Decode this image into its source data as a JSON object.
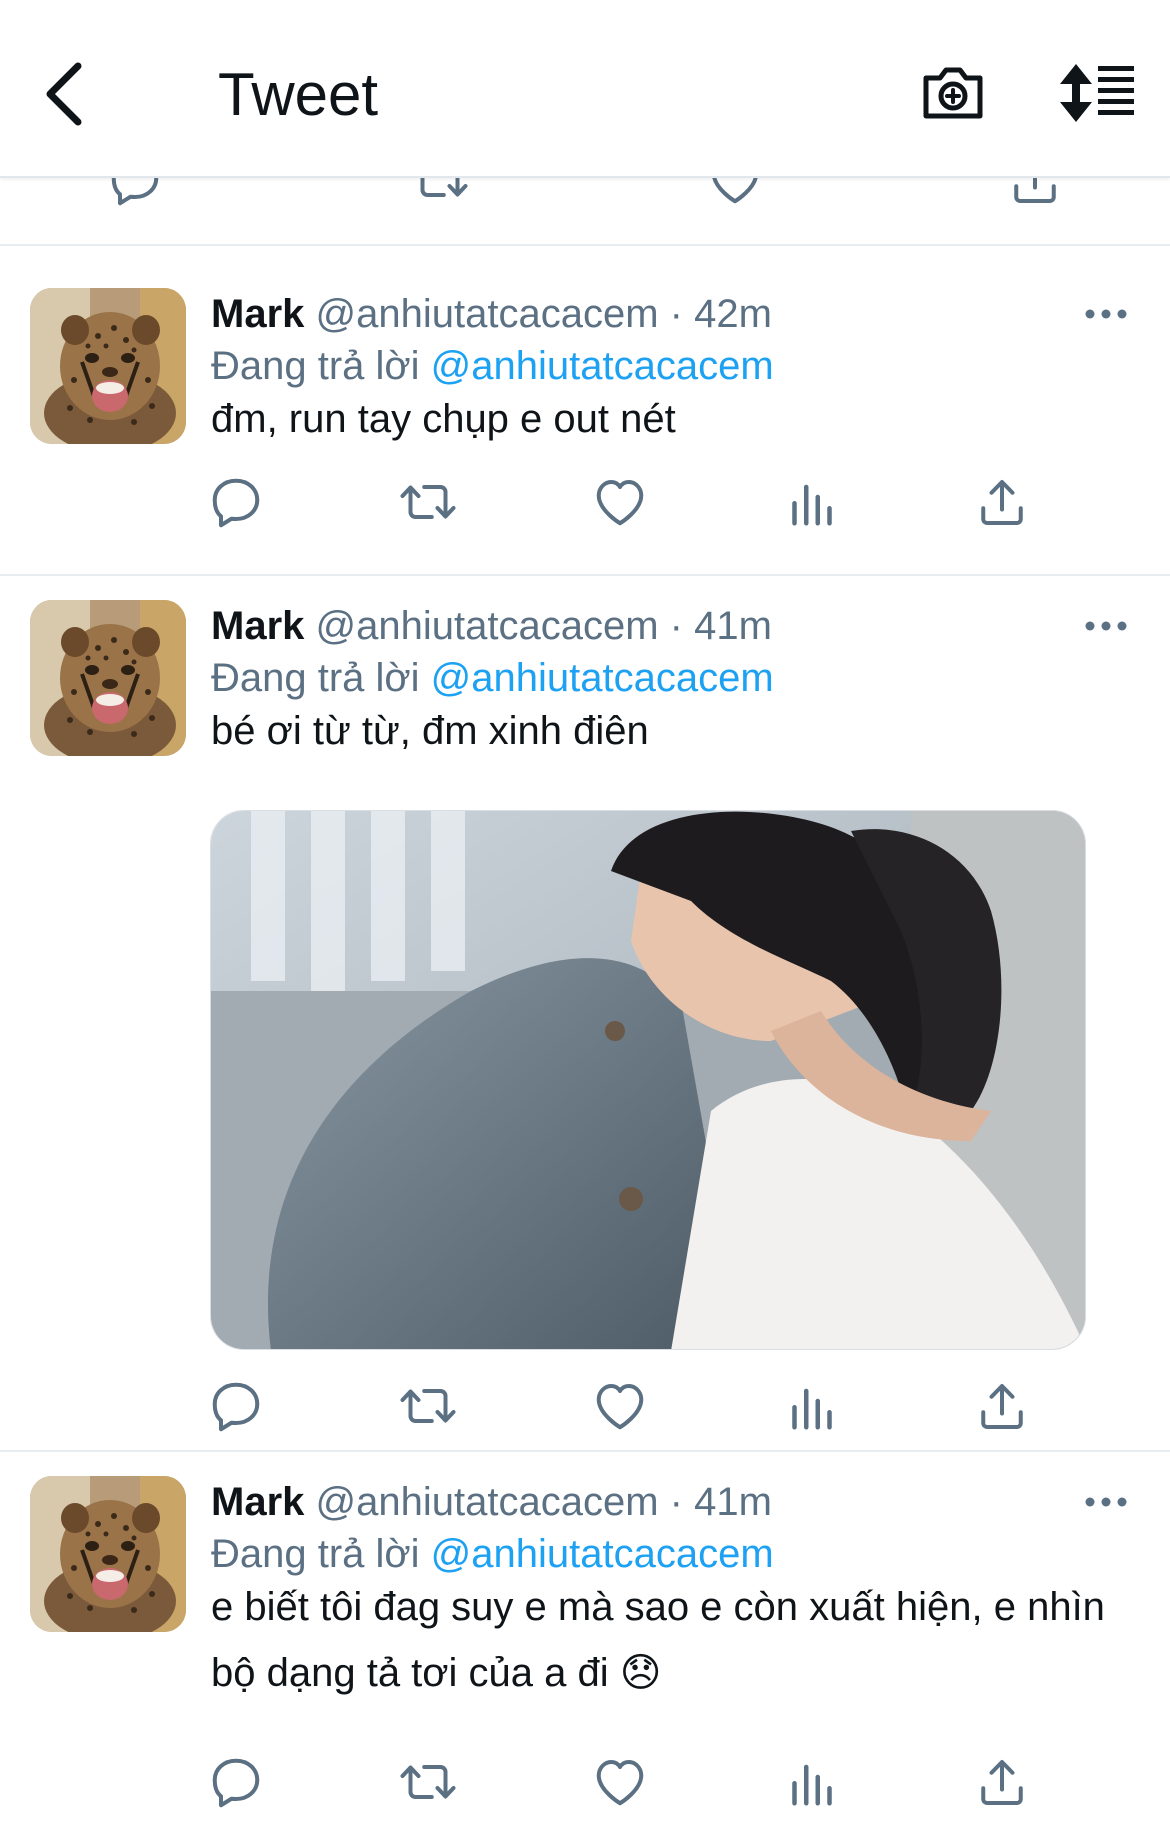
{
  "header": {
    "title": "Tweet",
    "back_icon": "chevron-left-icon",
    "camera_icon": "camera-icon",
    "sort_icon": "sort-icon"
  },
  "colors": {
    "accent": "#1da1f2",
    "secondary_text": "#5b7083",
    "divider": "#e6ecf0"
  },
  "tweets": [
    {
      "name": "Mark",
      "handle": "@anhiutatcacacem",
      "time": "· 42m",
      "reply_prefix": "Đang trả lời",
      "reply_to": "@anhiutatcacacem",
      "text": "đm, run tay chụp e out nét"
    },
    {
      "name": "Mark",
      "handle": "@anhiutatcacacem",
      "time": "· 41m",
      "reply_prefix": "Đang trả lời",
      "reply_to": "@anhiutatcacacem",
      "text": "bé ơi từ từ, đm xinh điên"
    },
    {
      "name": "Mark",
      "handle": "@anhiutatcacacem",
      "time": "· 41m",
      "reply_prefix": "Đang trả lời",
      "reply_to": "@anhiutatcacacem",
      "text": "e biết tôi đag suy e mà sao e còn xuất hiện, e nhìn bộ dạng tả tơi của a đi 😞"
    }
  ]
}
